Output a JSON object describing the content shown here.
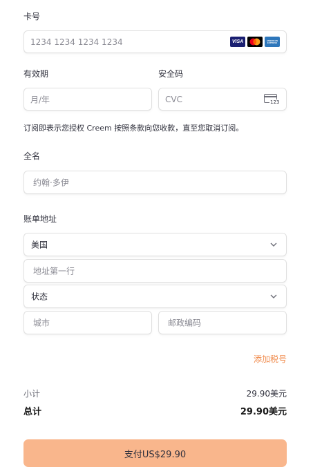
{
  "card": {
    "label": "卡号",
    "placeholder": "1234 1234 1234 1234",
    "brands": [
      "VISA",
      "mastercard-icon",
      "amex-icon"
    ],
    "visa_text": "VISA",
    "amex_text": "AMERICAN EXPRESS"
  },
  "expiry": {
    "label": "有效期",
    "placeholder": "月/年"
  },
  "cvc": {
    "label": "安全码",
    "placeholder": "CVC",
    "icon_text": "123"
  },
  "authorization_text": "订阅即表示您授权 Creem 按照条款向您收款，直至您取消订阅。",
  "name": {
    "label": "全名",
    "placeholder": "约翰·多伊"
  },
  "billing": {
    "label": "账单地址",
    "country": "美国",
    "address_placeholder": "地址第一行",
    "state": "状态",
    "city_placeholder": "城市",
    "zip_placeholder": "邮政编码"
  },
  "add_tax_id": "添加税号",
  "summary": {
    "subtotal_label": "小计",
    "subtotal_value": "29.90美元",
    "total_label": "总计",
    "total_value": "29.90美元"
  },
  "pay_button": "支付US$29.90",
  "colors": {
    "accent": "#f08a4b",
    "button_bg": "#f9b68c",
    "visa_blue": "#1a1f71",
    "amex_blue": "#2e77bb"
  }
}
